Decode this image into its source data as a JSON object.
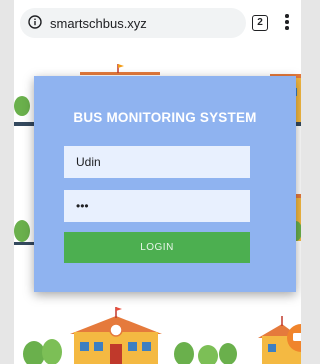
{
  "browser": {
    "url": "smartschbus.xyz",
    "tab_count": "2",
    "icons": {
      "info": "info-icon",
      "menu": "more-vertical-icon"
    }
  },
  "login": {
    "title": "BUS MONITORING SYSTEM",
    "username_value": "Udin",
    "password_value": "•••",
    "button_label": "LOGIN"
  },
  "colors": {
    "card": "#8fb3f0",
    "login_button": "#4caf50",
    "input_bg": "#e8f0fe"
  }
}
